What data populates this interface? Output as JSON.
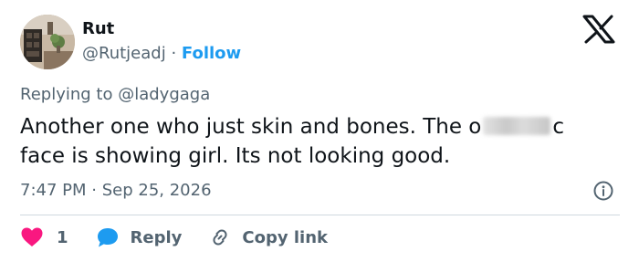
{
  "author": {
    "name": "Rut",
    "handle": "@Rutjeadj",
    "separator": "·",
    "follow_label": "Follow"
  },
  "reply_context": {
    "prefix": "Replying to",
    "mention": "@ladygaga"
  },
  "tweet": {
    "line1_before": "Another one who just skin and bones. The o",
    "line1_after": "c",
    "line2": "face is showing girl. Its not looking good."
  },
  "meta": {
    "time": "7:47 PM",
    "separator": "·",
    "date": "Sep 25, 2026"
  },
  "actions": {
    "like_count": "1",
    "reply_label": "Reply",
    "copy_label": "Copy link"
  },
  "colors": {
    "accent": "#1d9bf0",
    "like": "#f91880",
    "secondary_text": "#536471",
    "divider": "#cfd9de"
  },
  "icons": [
    "x-logo-icon",
    "info-icon",
    "heart-icon",
    "reply-bubble-icon",
    "link-icon"
  ]
}
